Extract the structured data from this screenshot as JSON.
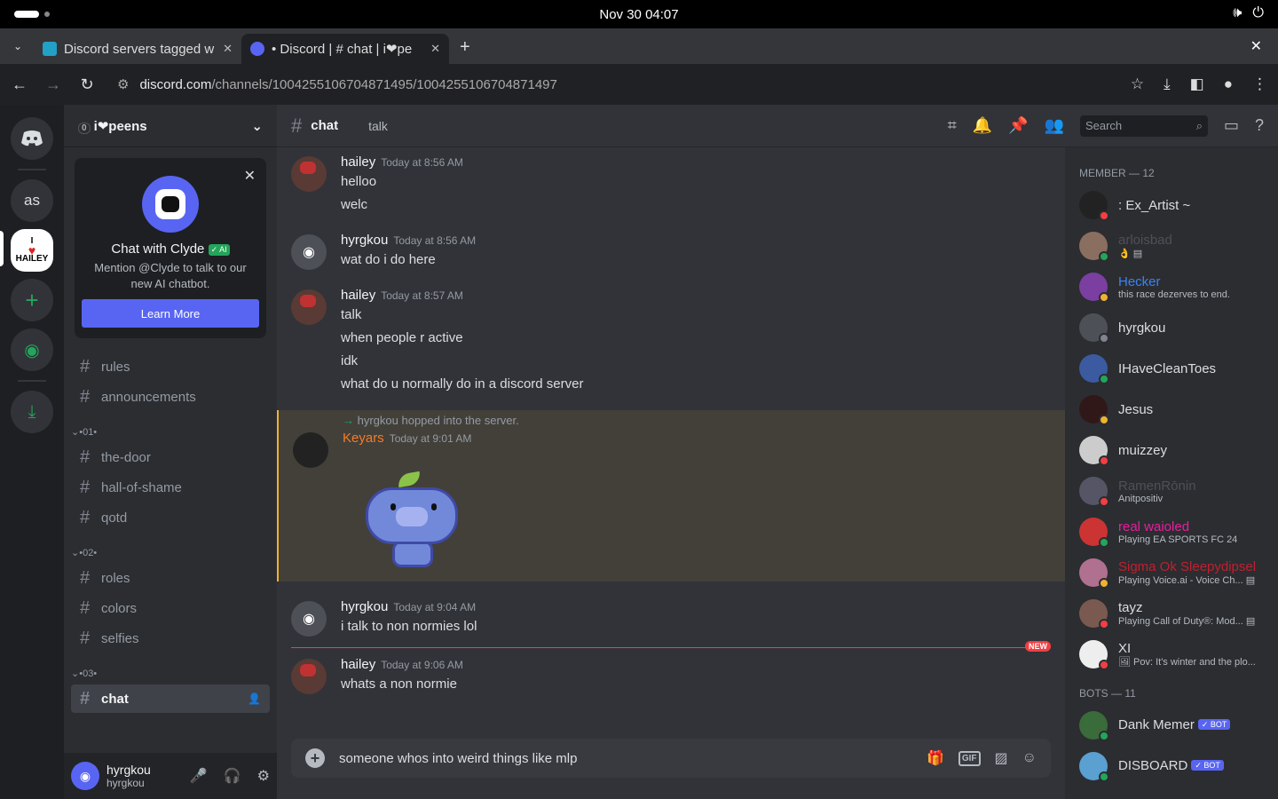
{
  "system": {
    "datetime": "Nov 30  04:07",
    "volume_icon": "🕪",
    "power_icon": "⏻"
  },
  "browser": {
    "tabs": [
      {
        "title": "Discord servers tagged w",
        "favicon_color": "#22a0c8"
      },
      {
        "title": "• Discord | # chat | i❤pe",
        "favicon_color": "#5865f2"
      }
    ],
    "url_host": "discord.com",
    "url_path": "/channels/1004255106704871495/1004255106704871497"
  },
  "guilds": {
    "as_label": "as",
    "hailey_top": "I",
    "hailey_bottom": "HAILEY"
  },
  "server": {
    "name": "i❤peens",
    "badge": "0",
    "clyde": {
      "title": "Chat with Clyde",
      "ai_tag": "✓ AI",
      "desc": "Mention @Clyde to talk to our new AI chatbot.",
      "button": "Learn More"
    },
    "channels_top": [
      "rules",
      "announcements"
    ],
    "cat1": "•01•",
    "channels1": [
      "the-door",
      "hall-of-shame",
      "qotd"
    ],
    "cat2": "•02•",
    "channels2": [
      "roles",
      "colors",
      "selfies"
    ],
    "cat3": "•03•",
    "active_channel": "chat"
  },
  "user": {
    "name": "hyrgkou",
    "tag": "hyrgkou"
  },
  "channel": {
    "name": "chat",
    "topic": "talk",
    "search_placeholder": "Search"
  },
  "messages": [
    {
      "author": "hailey",
      "time": "Today at 8:56 AM",
      "lines": [
        "helloo",
        "welc"
      ]
    },
    {
      "author": "hyrgkou",
      "time": "Today at 8:56 AM",
      "lines": [
        "wat do i do here"
      ]
    },
    {
      "author": "hailey",
      "time": "Today at 8:57 AM",
      "lines": [
        "talk",
        "when people r active",
        "idk",
        "what do u normally do in a discord server"
      ]
    },
    {
      "system": "hyrgkou hopped into the server.",
      "author": "Keyars",
      "time": "Today at 9:01 AM"
    },
    {
      "author": "hyrgkou",
      "time": "Today at 9:04 AM",
      "lines": [
        "i talk to non normies lol"
      ]
    },
    {
      "author": "hailey",
      "time": "Today at 9:06 AM",
      "lines": [
        "whats a non normie"
      ]
    }
  ],
  "new_label": "NEW",
  "composer_text": "someone whos into weird things like mlp",
  "members": {
    "member_header": "MEMBER — 12",
    "list": [
      {
        "name": ": Ex_Artist ~",
        "status": "",
        "color": "#dbdee1",
        "av": "#222",
        "st": "#f23f43"
      },
      {
        "name": "arloisbad",
        "status": "👌 ▤",
        "color": "#4e5058",
        "av": "#8a6e60",
        "st": "#23a55a"
      },
      {
        "name": "Hecker",
        "status": "this race dezerves to end.",
        "color": "#3b82f6",
        "av": "#7a3fa0",
        "st": "#f0b232"
      },
      {
        "name": "hyrgkou",
        "status": "",
        "color": "#dbdee1",
        "av": "#4e5058",
        "st": "#80848e"
      },
      {
        "name": "IHaveCleanToes",
        "status": "",
        "color": "#dbdee1",
        "av": "#3b5aa0",
        "st": "#23a55a"
      },
      {
        "name": "Jesus",
        "status": "",
        "color": "#dbdee1",
        "av": "#301818",
        "st": "#f0b232"
      },
      {
        "name": "muizzey",
        "status": "",
        "color": "#dbdee1",
        "av": "#ccc",
        "st": "#f23f43"
      },
      {
        "name": "RamenRōnin",
        "status": "Anitpositiv",
        "color": "#4e5058",
        "av": "#556",
        "st": "#f23f43"
      },
      {
        "name": "real waioled",
        "status": "Playing EA SPORTS FC 24",
        "color": "#e91e9e",
        "av": "#c33",
        "st": "#23a55a"
      },
      {
        "name": "Sigma Ok Sleepydipsel",
        "status": "Playing Voice.ai - Voice Ch... ▤",
        "color": "#c02030",
        "av": "#b07090",
        "st": "#f0b232"
      },
      {
        "name": "tayz",
        "status": "Playing Call of Duty®: Mod... ▤",
        "color": "#dbdee1",
        "av": "#7a5a50",
        "st": "#f23f43"
      },
      {
        "name": "XI",
        "status": "🖼 Pov: It's winter and the plo...",
        "color": "#dbdee1",
        "av": "#eee",
        "st": "#f23f43"
      }
    ],
    "bots_header": "BOTS — 11",
    "bots": [
      {
        "name": "Dank Memer",
        "badge": "✓ BOT",
        "av": "#3a6b3a",
        "st": "#23a55a"
      },
      {
        "name": "DISBOARD",
        "badge": "✓ BOT",
        "av": "#5aa0d0",
        "st": "#23a55a"
      }
    ]
  }
}
